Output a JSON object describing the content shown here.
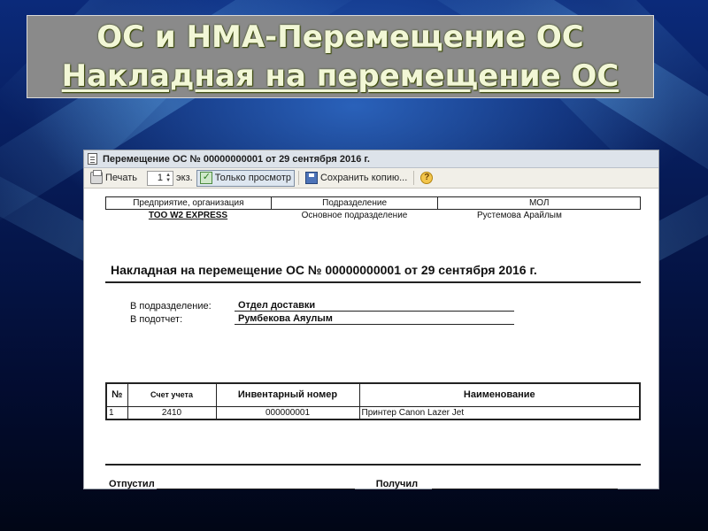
{
  "slide": {
    "title_line1": "ОС и НМА-Перемещение ОС",
    "title_line2": "Накладная на перемещение ОС"
  },
  "window": {
    "title": "Перемещение ОС № 00000000001 от 29 сентября 2016 г."
  },
  "toolbar": {
    "print_label": "Печать",
    "copies_value": "1",
    "copies_suffix": "экз.",
    "view_only_label": "Только просмотр",
    "save_copy_label": "Сохранить копию...",
    "help_label": "?"
  },
  "header_table": {
    "col1": "Предприятие, организация",
    "col2": "Подразделение",
    "col3": "МОЛ",
    "organization": "ТОО W2 EXPRESS",
    "department": "Основное подразделение",
    "mol": "Рустемова Арайлым"
  },
  "document": {
    "title": "Накладная на перемещение ОС  № 00000000001 от 29 сентября 2016 г.",
    "to_department_label": "В подразделение:",
    "to_department_value": "Отдел доставки",
    "to_person_label": "В подотчет:",
    "to_person_value": "Румбекова Аяулым"
  },
  "items_table": {
    "headers": [
      "№",
      "Счет учета",
      "Инвентарный номер",
      "Наименование"
    ],
    "rows": [
      [
        "1",
        "2410",
        "000000001",
        "Принтер Canon Lazer Jet"
      ]
    ]
  },
  "signatures": {
    "released_label": "Отпустил",
    "received_label": "Получил"
  }
}
